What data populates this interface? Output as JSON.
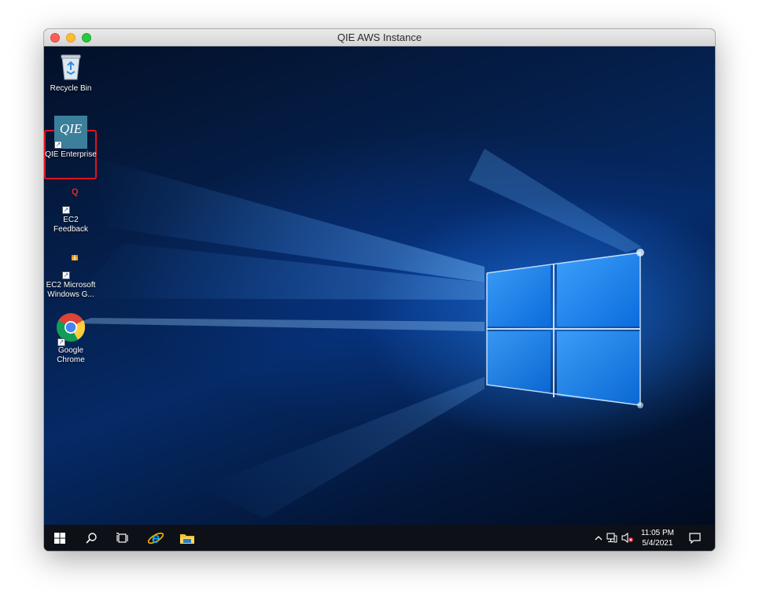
{
  "window": {
    "title": "QIE AWS Instance"
  },
  "desktop_icons": [
    {
      "label": "Recycle Bin",
      "icon": "recycle-bin-icon"
    },
    {
      "label": "QIE Enterprise",
      "icon": "qie-logo-icon",
      "logo_text": "QIE"
    },
    {
      "label": "EC2 Feedback",
      "icon": "ec2-feedback-icon",
      "glyph": "Q"
    },
    {
      "label_line1": "EC2 Microsoft",
      "label_line2": "Windows G...",
      "icon": "ec2-windows-guide-icon"
    },
    {
      "label_line1": "Google",
      "label_line2": "Chrome",
      "icon": "chrome-icon"
    }
  ],
  "taskbar": {
    "buttons": [
      "start-button",
      "search-button",
      "task-view-button",
      "internet-explorer-button",
      "file-explorer-button"
    ],
    "tray_icons": [
      "chevron-up-icon",
      "network-icon",
      "volume-muted-icon"
    ],
    "time": "11:05 PM",
    "date": "5/4/2021",
    "notification_icon": "notification-icon"
  },
  "colors": {
    "selection_border": "#e0141e",
    "qie_tile": "#3c7f9b",
    "taskbar": "#0d1016"
  }
}
